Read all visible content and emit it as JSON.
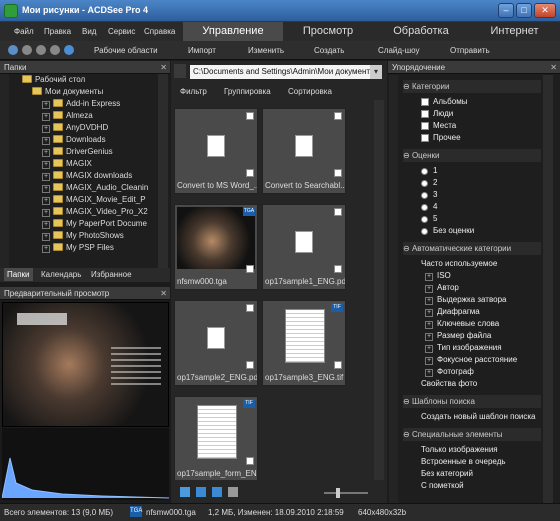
{
  "window": {
    "title": "Мои рисунки - ACDSee Pro 4",
    "min": "–",
    "max": "□",
    "close": "✕"
  },
  "menu": [
    "Файл",
    "Правка",
    "Вид",
    "Сервис",
    "Справка"
  ],
  "modes": [
    "Управление",
    "Просмотр",
    "Обработка",
    "Интернет"
  ],
  "toolbar": [
    "Рабочие области",
    "Импорт",
    "Изменить",
    "Создать",
    "Слайд-шоу",
    "Отправить"
  ],
  "folders": {
    "title": "Папки",
    "close": "✕",
    "tree": [
      {
        "label": "Рабочий стол",
        "level": 0
      },
      {
        "label": "Мои документы",
        "level": 1
      },
      {
        "label": "Add-in Express",
        "level": 2
      },
      {
        "label": "Almeza",
        "level": 2
      },
      {
        "label": "AnyDVDHD",
        "level": 2
      },
      {
        "label": "Downloads",
        "level": 2
      },
      {
        "label": "DriverGenius",
        "level": 2
      },
      {
        "label": "MAGIX",
        "level": 2
      },
      {
        "label": "MAGIX downloads",
        "level": 2
      },
      {
        "label": "MAGIX_Audio_Cleanin",
        "level": 2
      },
      {
        "label": "MAGIX_Movie_Edit_P",
        "level": 2
      },
      {
        "label": "MAGIX_Video_Pro_X2",
        "level": 2
      },
      {
        "label": "My PaperPort Docume",
        "level": 2
      },
      {
        "label": "My PhotoShows",
        "level": 2
      },
      {
        "label": "My PSP Files",
        "level": 2
      }
    ],
    "tabs": [
      "Папки",
      "Календарь",
      "Избранное"
    ]
  },
  "preview": {
    "title": "Предварительный просмотр",
    "image": "game-cover-poster"
  },
  "path": {
    "value": "C:\\Documents and Settings\\Admin\\Мои документы"
  },
  "filters": [
    "Фильтр",
    "Группировка",
    "Сортировка"
  ],
  "thumbs": [
    {
      "label": "Convert to MS Word_...",
      "type": "doc-icon"
    },
    {
      "label": "Convert to Searchabl...",
      "type": "doc-icon"
    },
    {
      "label": "nfsmw000.tga",
      "type": "photo",
      "badge": "TGA"
    },
    {
      "label": "op17sample1_ENG.pdf",
      "type": "doc-icon"
    },
    {
      "label": "op17sample2_ENG.pdf",
      "type": "doc-icon"
    },
    {
      "label": "op17sample3_ENG.tif",
      "type": "page",
      "badge": "TIF"
    },
    {
      "label": "op17sample_form_EN...",
      "type": "page",
      "badge": "TIF"
    }
  ],
  "organize": {
    "title": "Упорядочение",
    "categories_title": "Категории",
    "categories": [
      "Альбомы",
      "Люди",
      "Места",
      "Прочее"
    ],
    "ratings_title": "Оценки",
    "ratings": [
      "1",
      "2",
      "3",
      "4",
      "5",
      "Без оценки"
    ],
    "auto_title": "Автоматические категории",
    "auto_header": "Часто используемое",
    "auto_items": [
      "ISO",
      "Автор",
      "Выдержка затвора",
      "Диафрагма",
      "Ключевые слова",
      "Размер файла",
      "Тип изображения",
      "Фокусное расстояние",
      "Фотограф"
    ],
    "auto_footer": "Свойства фото",
    "search_title": "Шаблоны поиска",
    "search_new": "Создать новый шаблон поиска",
    "special_title": "Специальные элементы",
    "special": [
      "Только изображения",
      "Встроенные в очередь",
      "Без категорий",
      "С пометкой"
    ]
  },
  "status": {
    "count": "Всего элементов: 13  (9,0 МБ)",
    "file": "nfsmw000.tga",
    "info": "1,2 МБ, Изменен: 18.09.2010 2:18:59",
    "dims": "640x480x32b",
    "badge": "TGA"
  }
}
